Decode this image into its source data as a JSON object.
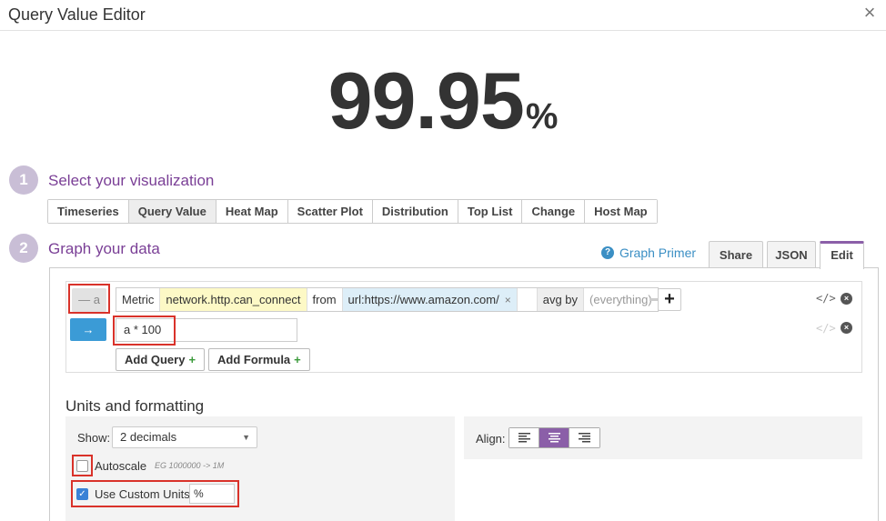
{
  "dialog": {
    "title": "Query Value Editor",
    "close": "×"
  },
  "value": {
    "number": "99.95",
    "unit": "%"
  },
  "steps": [
    {
      "num": "1",
      "title": "Select your visualization"
    },
    {
      "num": "2",
      "title": "Graph your data"
    }
  ],
  "viz_tabs": [
    "Timeseries",
    "Query Value",
    "Heat Map",
    "Scatter Plot",
    "Distribution",
    "Top List",
    "Change",
    "Host Map"
  ],
  "viz_active": "Query Value",
  "graph_primer": "Graph Primer",
  "edit_tabs": [
    "Share",
    "JSON",
    "Edit"
  ],
  "edit_active": "Edit",
  "query": {
    "letter": "— a",
    "metric_label": "Metric",
    "metric": "network.http.can_connect",
    "from_label": "from",
    "tag": "url:https://www.amazon.com/",
    "tag_remove": "×",
    "avg_by": "avg by",
    "group": "(everything)",
    "add": "+"
  },
  "formula": {
    "arrow": "→",
    "value": "a * 100"
  },
  "buttons": {
    "add_query": "Add Query",
    "add_formula": "Add Formula",
    "plus": "+"
  },
  "code_icon": "</>",
  "remove_icon": "×",
  "units": {
    "title": "Units and formatting",
    "show_label": "Show:",
    "show_value": "2 decimals",
    "autoscale_label": "Autoscale",
    "autoscale_checked": false,
    "autoscale_example": "EG 1000000 -> 1M",
    "custom_units_label": "Use Custom Units",
    "custom_units_checked": true,
    "custom_units_value": "%",
    "align_label": "Align:",
    "align_options": [
      "left",
      "center",
      "right"
    ],
    "align_active": "center"
  },
  "colors": {
    "accent": "#8b5fa8",
    "link": "#3b8fc4",
    "highlight": "#d9322a"
  }
}
